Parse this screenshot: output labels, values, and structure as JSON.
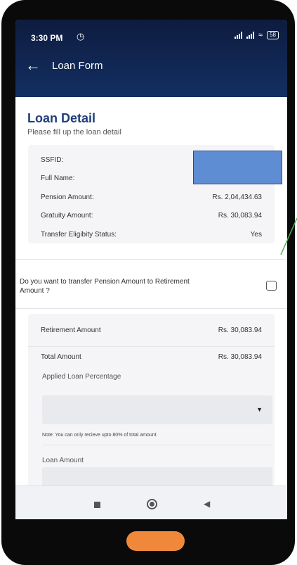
{
  "status": {
    "time": "3:30 PM",
    "alarm_icon": "alarm-icon",
    "battery": "58"
  },
  "appbar": {
    "title": "Loan Form",
    "back_icon": "back-arrow-icon"
  },
  "loan_detail": {
    "title": "Loan Detail",
    "subtitle": "Please fill up the loan detail",
    "rows": [
      {
        "label": "SSFID:",
        "value": ""
      },
      {
        "label": "Full Name:",
        "value": ""
      },
      {
        "label": "Pension Amount:",
        "value": "Rs. 2,04,434.63"
      },
      {
        "label": "Gratuity Amount:",
        "value": "Rs. 30,083.94"
      },
      {
        "label": "Transfer Eligibity Status:",
        "value": "Yes"
      }
    ]
  },
  "transfer": {
    "question": "Do you want to transfer Pension Amount to Retirement Amount ?",
    "checked": false
  },
  "summary": {
    "retirement_label": "Retirement Amount",
    "retirement_value": "Rs. 30,083.94",
    "total_label": "Total Amount",
    "total_value": "Rs. 30,083.94",
    "applied_label": "Applied Loan Percentage",
    "applied_value": "",
    "note": "Note: You can only recieve upto 80% of total amount",
    "loan_amount_label": "Loan Amount",
    "loan_amount_value": ""
  },
  "colors": {
    "header": "#132f62",
    "title": "#1f3e7a",
    "redaction": "#5f8dd4",
    "home_pill": "#f0883c",
    "annotation": "#4caf50"
  }
}
